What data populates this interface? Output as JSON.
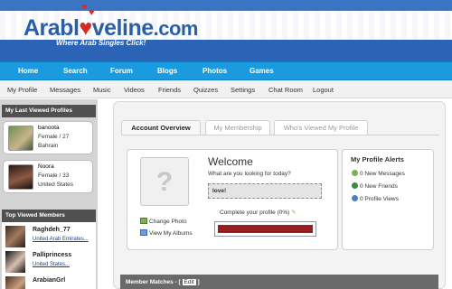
{
  "header": {
    "logo_prefix": "Arabl",
    "logo_heart": "♥",
    "logo_suffix": "veline",
    "logo_tld": ".com",
    "tagline": "Where Arab Singles Click!"
  },
  "main_nav": [
    "Home",
    "Search",
    "Forum",
    "Blogs",
    "Photos",
    "Games"
  ],
  "sub_nav": [
    "My Profile",
    "Messages",
    "Music",
    "Videos",
    "Friends",
    "Quizzes",
    "Settings",
    "Chat Room",
    "Logout"
  ],
  "last_viewed": {
    "title": "My Last Viewed Profiles",
    "profiles": [
      {
        "name": "banoota",
        "info": "Female / 27",
        "location": "Bahrain"
      },
      {
        "name": "Noora",
        "info": "Female / 33",
        "location": "United States"
      }
    ]
  },
  "top_viewed": {
    "title": "Top Viewed Members",
    "members": [
      {
        "name": "Raghdeh_77",
        "location": "United Arab Emirates..."
      },
      {
        "name": "Palliprincess",
        "location": "United States..."
      },
      {
        "name": "ArabianGrl",
        "location": ""
      }
    ]
  },
  "tabs": {
    "account_overview": "Account Overview",
    "my_membership": "My Membership",
    "whos_viewed": "Who's Viewed My Profile"
  },
  "welcome": {
    "title": "Welcome",
    "question": "What are you looking for today?",
    "answer": "love!",
    "complete_text": "Complete your profile (0%)",
    "profile_completion": 0,
    "change_photo": "Change Photo",
    "view_albums": "View My Albums"
  },
  "alerts": {
    "title": "My Profile Alerts",
    "messages": "0 New Messages",
    "friends": "0 New Friends",
    "views": "0 Profile Views"
  },
  "matches": {
    "label": "Member Matches - [",
    "edit": "Edit",
    "suffix": "]"
  },
  "colors": {
    "nav_blue": "#1a9be0",
    "progress_red": "#b42020",
    "panel_dark": "#505050"
  }
}
